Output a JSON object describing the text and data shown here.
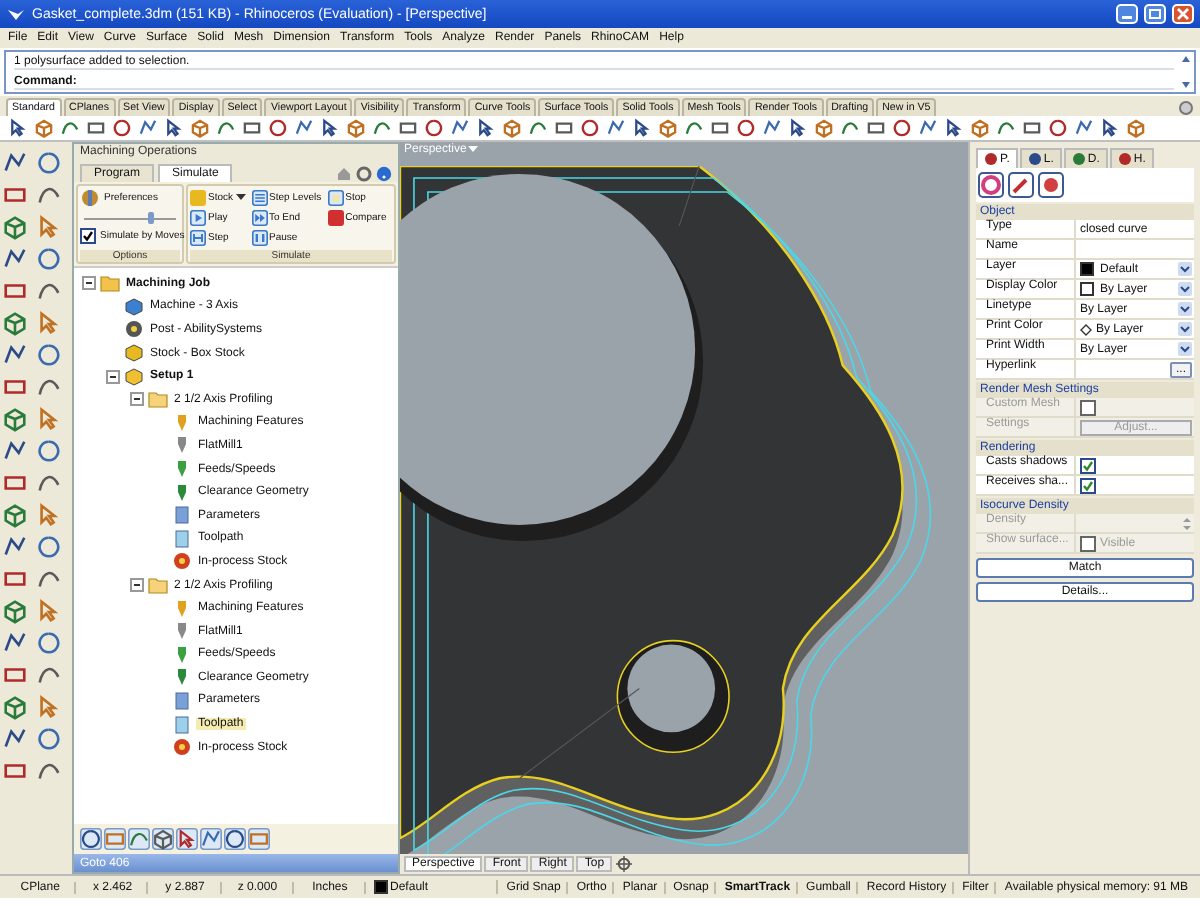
{
  "window": {
    "title": "Gasket_complete.3dm (151 KB) - Rhinoceros (Evaluation) - [Perspective]"
  },
  "menu": [
    "File",
    "Edit",
    "View",
    "Curve",
    "Surface",
    "Solid",
    "Mesh",
    "Dimension",
    "Transform",
    "Tools",
    "Analyze",
    "Render",
    "Panels",
    "RhinoCAM",
    "Help"
  ],
  "command": {
    "history": "1 polysurface added to selection.",
    "prompt": "Command:"
  },
  "toolbar_tabs": [
    {
      "label": "Standard",
      "selected": true
    },
    {
      "label": "CPlanes",
      "selected": false
    },
    {
      "label": "Set View",
      "selected": false
    },
    {
      "label": "Display",
      "selected": false
    },
    {
      "label": "Select",
      "selected": false
    },
    {
      "label": "Viewport Layout",
      "selected": false
    },
    {
      "label": "Visibility",
      "selected": false
    },
    {
      "label": "Transform",
      "selected": false
    },
    {
      "label": "Curve Tools",
      "selected": false
    },
    {
      "label": "Surface Tools",
      "selected": false
    },
    {
      "label": "Solid Tools",
      "selected": false
    },
    {
      "label": "Mesh Tools",
      "selected": false
    },
    {
      "label": "Render Tools",
      "selected": false
    },
    {
      "label": "Drafting",
      "selected": false
    },
    {
      "label": "New in V5",
      "selected": false
    }
  ],
  "machining": {
    "title": "Machining Operations",
    "tabs": [
      {
        "label": "Program",
        "selected": false
      },
      {
        "label": "Simulate",
        "selected": true
      }
    ],
    "options": {
      "preferences": "Preferences",
      "speed": {
        "level": 0.7
      },
      "simulate_by_moves": {
        "label": "Simulate by Moves",
        "checked": true
      },
      "label": "Options"
    },
    "simulate": {
      "label": "Simulate",
      "buttons": [
        {
          "label": "Stock",
          "kind": "stock"
        },
        {
          "label": "Play",
          "kind": "play"
        },
        {
          "label": "Step",
          "kind": "step"
        },
        {
          "label": "Step Levels",
          "kind": "step_levels"
        },
        {
          "label": "To End",
          "kind": "to_end"
        },
        {
          "label": "Pause",
          "kind": "pause"
        },
        {
          "label": "Stop",
          "kind": "stop"
        },
        {
          "label": "Compare",
          "kind": "compare"
        }
      ]
    },
    "tree": [
      {
        "label": "Machining Job",
        "kind": "job",
        "selected": false,
        "expanded": true,
        "children": [
          {
            "label": "Machine - 3 Axis",
            "kind": "machine",
            "selected": false
          },
          {
            "label": "Post - AbilitySystems",
            "kind": "post",
            "selected": false
          },
          {
            "label": "Stock - Box Stock",
            "kind": "stock",
            "selected": false
          },
          {
            "label": "Setup 1",
            "kind": "setup",
            "selected": false,
            "expanded": true,
            "children": [
              {
                "label": "2 1/2 Axis Profiling",
                "kind": "folder",
                "selected": false,
                "expanded": true,
                "children": [
                  {
                    "label": "Machining Features",
                    "kind": "features",
                    "selected": false
                  },
                  {
                    "label": "FlatMill1",
                    "kind": "tool",
                    "selected": false
                  },
                  {
                    "label": "Feeds/Speeds",
                    "kind": "feeds",
                    "selected": false
                  },
                  {
                    "label": "Clearance Geometry",
                    "kind": "clearance",
                    "selected": false
                  },
                  {
                    "label": "Parameters",
                    "kind": "parameters",
                    "selected": false
                  },
                  {
                    "label": "Toolpath",
                    "kind": "toolpath",
                    "selected": false
                  },
                  {
                    "label": "In-process Stock",
                    "kind": "inprocess",
                    "selected": false
                  }
                ]
              },
              {
                "label": "2 1/2 Axis Profiling",
                "kind": "folder",
                "selected": false,
                "expanded": true,
                "children": [
                  {
                    "label": "Machining Features",
                    "kind": "features",
                    "selected": false
                  },
                  {
                    "label": "FlatMill1",
                    "kind": "tool",
                    "selected": false
                  },
                  {
                    "label": "Feeds/Speeds",
                    "kind": "feeds",
                    "selected": false
                  },
                  {
                    "label": "Clearance Geometry",
                    "kind": "clearance",
                    "selected": false
                  },
                  {
                    "label": "Parameters",
                    "kind": "parameters",
                    "selected": false
                  },
                  {
                    "label": "Toolpath",
                    "kind": "toolpath",
                    "selected": true
                  },
                  {
                    "label": "In-process Stock",
                    "kind": "inprocess",
                    "selected": false
                  }
                ]
              }
            ]
          }
        ]
      }
    ],
    "status": "Goto 406"
  },
  "viewport": {
    "label": "Perspective",
    "tabs": [
      {
        "label": "Perspective",
        "selected": true
      },
      {
        "label": "Front",
        "selected": false
      },
      {
        "label": "Right",
        "selected": false
      },
      {
        "label": "Top",
        "selected": false
      }
    ]
  },
  "properties": {
    "tabs": [
      {
        "label": "P.",
        "selected": true
      },
      {
        "label": "L.",
        "selected": false
      },
      {
        "label": "D.",
        "selected": false
      },
      {
        "label": "H.",
        "selected": false
      }
    ],
    "sections": [
      {
        "title": "Object",
        "rows": [
          {
            "label": "Type",
            "kind": "text",
            "value": "closed curve",
            "disabled": false
          },
          {
            "label": "Name",
            "kind": "text",
            "disabled": false
          },
          {
            "label": "Layer",
            "kind": "color_dropdown",
            "value": "Default",
            "color": "#000000",
            "disabled": false
          },
          {
            "label": "Display Color",
            "kind": "color_dropdown",
            "value": "By Layer",
            "color": "#ffffff",
            "disabled": false
          },
          {
            "label": "Linetype",
            "kind": "dropdown",
            "value": "By Layer",
            "disabled": false
          },
          {
            "label": "Print Color",
            "kind": "diamond_dropdown",
            "value": "By Layer",
            "disabled": false
          },
          {
            "label": "Print Width",
            "kind": "dropdown",
            "value": "By Layer",
            "disabled": false
          },
          {
            "label": "Hyperlink",
            "kind": "browse",
            "value": "...",
            "disabled": false
          }
        ]
      },
      {
        "title": "Render Mesh Settings",
        "rows": [
          {
            "label": "Custom Mesh",
            "kind": "checkbox",
            "checked": false,
            "disabled": true
          },
          {
            "label": "Settings",
            "kind": "button",
            "value": "Adjust...",
            "disabled": true
          }
        ]
      },
      {
        "title": "Rendering",
        "rows": [
          {
            "label": "Casts shadows",
            "kind": "checkbox",
            "checked": true,
            "disabled": false
          },
          {
            "label": "Receives sha...",
            "kind": "checkbox",
            "checked": true,
            "disabled": false
          }
        ]
      },
      {
        "title": "Isocurve Density",
        "rows": [
          {
            "label": "Density",
            "kind": "spinner",
            "disabled": true
          },
          {
            "label": "Show surface...",
            "kind": "checkbox",
            "value": "Visible",
            "checked": false,
            "disabled": true
          }
        ]
      }
    ],
    "buttons": [
      "Match",
      "Details..."
    ]
  },
  "status_bar": {
    "cplane": "CPlane",
    "x": "x 2.462",
    "y": "y 2.887",
    "z": "z 0.000",
    "units": "Inches",
    "layer": {
      "name": "Default",
      "color": "#000000"
    },
    "toggles": [
      {
        "label": "Grid Snap",
        "on": false
      },
      {
        "label": "Ortho",
        "on": false
      },
      {
        "label": "Planar",
        "on": false
      },
      {
        "label": "Osnap",
        "on": false
      },
      {
        "label": "SmartTrack",
        "on": true
      },
      {
        "label": "Gumball",
        "on": false
      },
      {
        "label": "Record History",
        "on": false
      },
      {
        "label": "Filter",
        "on": false
      }
    ],
    "memory": "Available physical memory: 91 MB"
  }
}
